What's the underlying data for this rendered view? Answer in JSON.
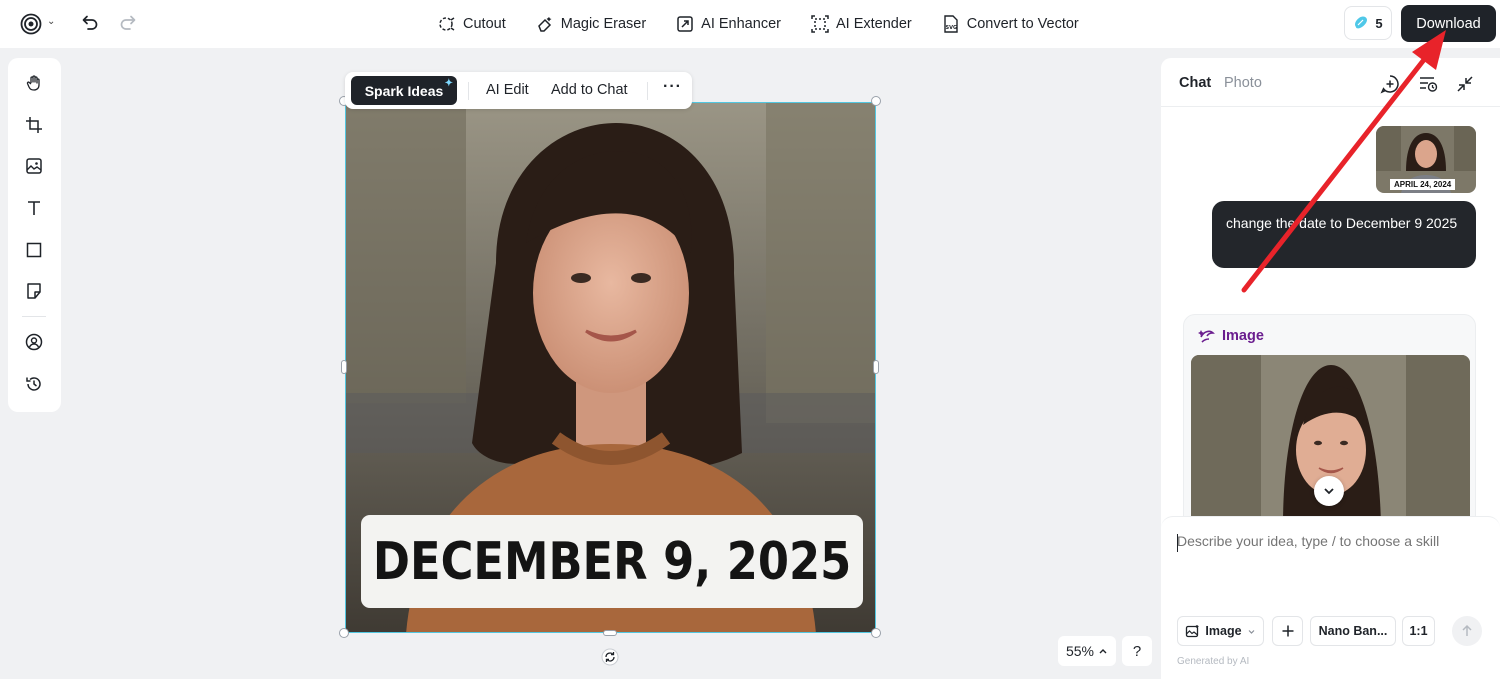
{
  "topbar": {
    "tools": [
      {
        "label": "Cutout",
        "icon": "cutout-icon"
      },
      {
        "label": "Magic Eraser",
        "icon": "eraser-icon"
      },
      {
        "label": "AI Enhancer",
        "icon": "enhancer-icon"
      },
      {
        "label": "AI Extender",
        "icon": "extender-icon"
      },
      {
        "label": "Convert to Vector",
        "icon": "svg-icon"
      }
    ],
    "credits": "5",
    "download_label": "Download"
  },
  "floatbar": {
    "spark_label": "Spark Ideas",
    "ai_edit_label": "AI Edit",
    "add_to_chat_label": "Add to Chat",
    "more_label": "···"
  },
  "canvas": {
    "date_text": "DECEMBER 9, 2025",
    "zoom": "55%",
    "help": "?"
  },
  "panel": {
    "tabs": [
      "Chat",
      "Photo"
    ],
    "thumb_label": "APRIL 24, 2024",
    "user_message": "change the date to December 9 2025",
    "response_title": "Image",
    "composer_placeholder": "Describe your idea, type / to choose a skill",
    "chip_image": "Image",
    "chip_model": "Nano Ban...",
    "chip_ratio": "1:1",
    "generated_note": "Generated by AI"
  },
  "colors": {
    "accent_dark": "#1f2329",
    "selection": "#52c7e0",
    "annotation_red": "#e8232a",
    "response_purple": "#6b1e8f"
  }
}
